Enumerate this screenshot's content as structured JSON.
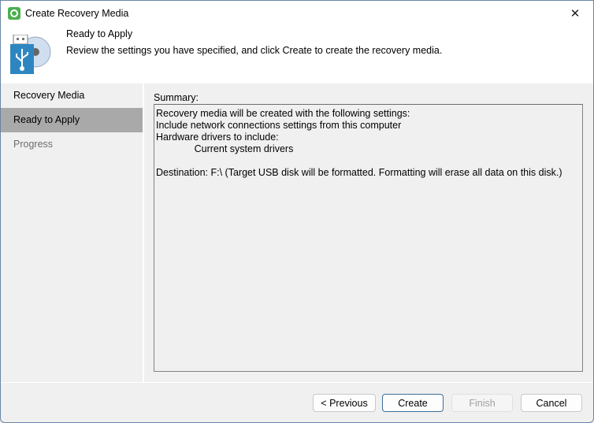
{
  "window": {
    "title": "Create Recovery Media",
    "close_label": "✕"
  },
  "header": {
    "title": "Ready to Apply",
    "description": "Review the settings you have specified, and click Create to create the recovery media."
  },
  "sidebar": {
    "items": [
      {
        "label": "Recovery Media",
        "state": "normal"
      },
      {
        "label": "Ready to Apply",
        "state": "selected"
      },
      {
        "label": "Progress",
        "state": "disabled"
      }
    ]
  },
  "summary": {
    "label": "Summary:",
    "text": "Recovery media will be created with the following settings:\nInclude network connections settings from this computer\nHardware drivers to include:\n              Current system drivers\n\nDestination: F:\\ (Target USB disk will be formatted. Formatting will erase all data on this disk.)"
  },
  "buttons": {
    "previous": "< Previous",
    "create": "Create",
    "finish": "Finish",
    "cancel": "Cancel"
  },
  "colors": {
    "selected_bg": "#a9a9a9",
    "accent": "#3d6e96",
    "app_icon": "#4caf50",
    "usb_blue": "#2e86c1"
  }
}
